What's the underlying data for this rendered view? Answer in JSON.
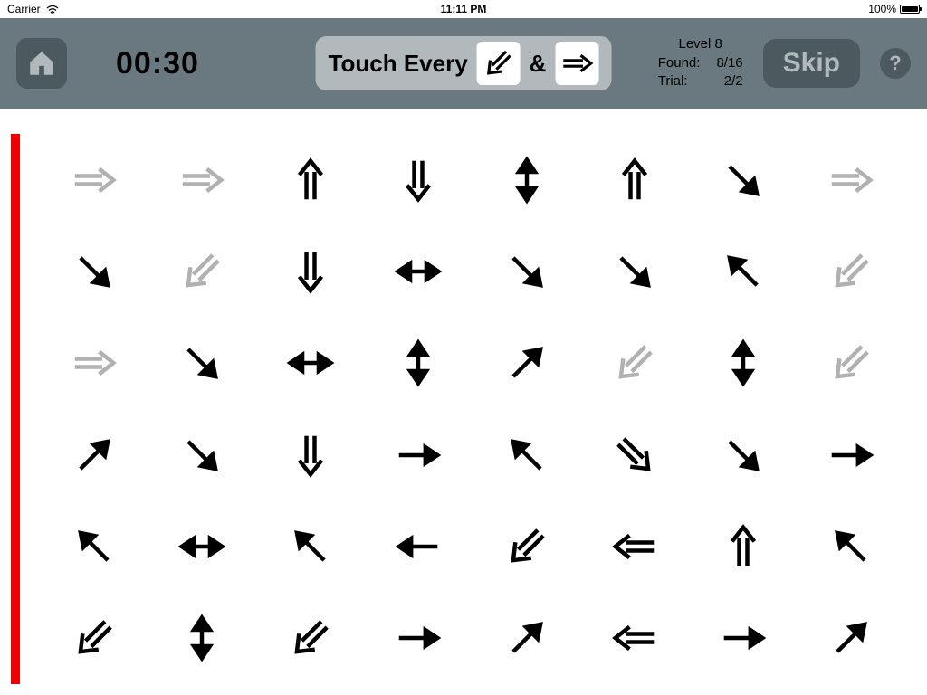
{
  "statusbar": {
    "carrier": "Carrier",
    "time": "11:11 PM",
    "battery_pct": "100%"
  },
  "header": {
    "timer": "00:30",
    "instruction_label": "Touch Every",
    "amp": "&",
    "target1": {
      "type": "dbl_sw",
      "name": "arrow-double-down-left"
    },
    "target2": {
      "type": "dbl_e",
      "name": "arrow-double-right"
    }
  },
  "stats": {
    "level_label": "Level 8",
    "found_label": "Found:",
    "found_value": "8/16",
    "trial_label": "Trial:",
    "trial_value": "2/2"
  },
  "buttons": {
    "skip": "Skip",
    "help": "?"
  },
  "grid_legend": "types: dbl_n dbl_s dbl_e dbl_w dbl_ne dbl_nw dbl_se dbl_sw bi_h bi_v single_n single_s single_e single_w single_ne single_nw single_se single_sw",
  "grid": [
    [
      {
        "t": "dbl_e",
        "dim": true
      },
      {
        "t": "dbl_e",
        "dim": true
      },
      {
        "t": "dbl_n"
      },
      {
        "t": "dbl_s"
      },
      {
        "t": "bi_v"
      },
      {
        "t": "dbl_n"
      },
      {
        "t": "single_se"
      },
      {
        "t": "dbl_e",
        "dim": true
      }
    ],
    [
      {
        "t": "single_se"
      },
      {
        "t": "dbl_sw",
        "dim": true
      },
      {
        "t": "dbl_s"
      },
      {
        "t": "bi_h"
      },
      {
        "t": "single_se"
      },
      {
        "t": "single_se"
      },
      {
        "t": "single_nw"
      },
      {
        "t": "dbl_sw",
        "dim": true
      }
    ],
    [
      {
        "t": "dbl_e",
        "dim": true
      },
      {
        "t": "single_se"
      },
      {
        "t": "bi_h"
      },
      {
        "t": "bi_v"
      },
      {
        "t": "single_ne"
      },
      {
        "t": "dbl_sw",
        "dim": true
      },
      {
        "t": "bi_v"
      },
      {
        "t": "dbl_sw",
        "dim": true
      }
    ],
    [
      {
        "t": "single_ne"
      },
      {
        "t": "single_se"
      },
      {
        "t": "dbl_s"
      },
      {
        "t": "single_e"
      },
      {
        "t": "single_nw"
      },
      {
        "t": "dbl_se"
      },
      {
        "t": "single_se"
      },
      {
        "t": "single_e"
      }
    ],
    [
      {
        "t": "single_nw"
      },
      {
        "t": "bi_h"
      },
      {
        "t": "single_nw"
      },
      {
        "t": "single_w"
      },
      {
        "t": "dbl_sw"
      },
      {
        "t": "dbl_w"
      },
      {
        "t": "dbl_n"
      },
      {
        "t": "single_nw"
      }
    ],
    [
      {
        "t": "dbl_sw"
      },
      {
        "t": "bi_v"
      },
      {
        "t": "dbl_sw"
      },
      {
        "t": "single_e"
      },
      {
        "t": "single_ne"
      },
      {
        "t": "dbl_w"
      },
      {
        "t": "single_e"
      },
      {
        "t": "single_ne"
      }
    ]
  ]
}
